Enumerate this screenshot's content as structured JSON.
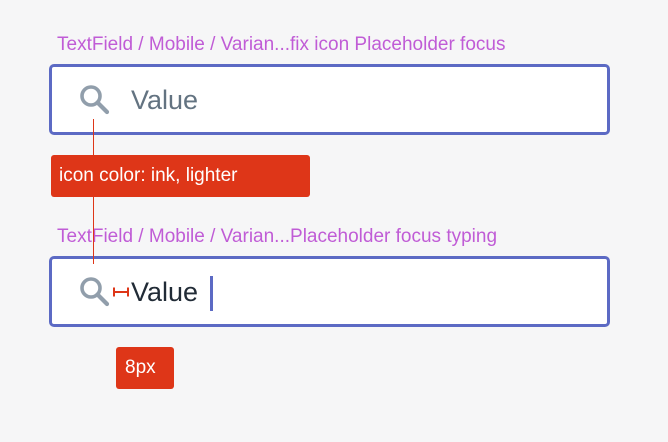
{
  "frames": [
    {
      "title": "TextField / Mobile / Varian...fix icon Placeholder focus",
      "field": {
        "icon": "search-icon",
        "placeholder": "Value",
        "state": "focus"
      }
    },
    {
      "title": "TextField / Mobile / Varian...Placeholder focus typing",
      "field": {
        "icon": "search-icon",
        "value": "Value",
        "state": "focus typing"
      }
    }
  ],
  "annotations": {
    "icon_color": "icon color: ink, lighter",
    "spacing": "8px"
  },
  "colors": {
    "frame_label": "#c05cd6",
    "focus_border": "#5c6ac4",
    "icon": "#919eab",
    "placeholder": "#637381",
    "text": "#212b36",
    "annotation": "#de3618",
    "background": "#f6f6f7"
  }
}
